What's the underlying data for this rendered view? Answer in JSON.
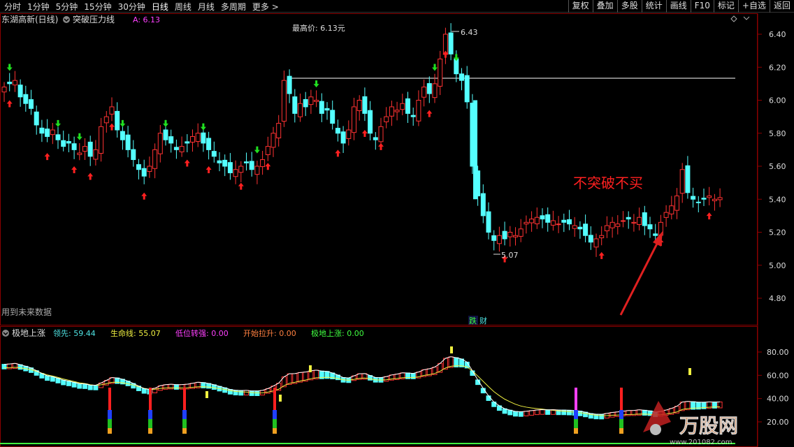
{
  "toolbar": {
    "left_items": [
      "分时",
      "1分钟",
      "5分钟",
      "15分钟",
      "30分钟",
      "日线",
      "周线",
      "月线",
      "多周期",
      "更多 >"
    ],
    "right_items": [
      "复权",
      "叠加",
      "多股",
      "统计",
      "画线",
      "F10",
      "标记",
      "+自选",
      "返回"
    ]
  },
  "main_panel": {
    "stock_name": "东湖高新(日线)",
    "indicator_name": "突破压力线",
    "indicator_value": "A: 6.13",
    "top_note": "最高价: 6.13元",
    "future_note": "用到未来数据",
    "annotation": "不突破不买",
    "high_label": "6.43",
    "low_label": "5.07",
    "badge_1": "跌",
    "badge_2": "财",
    "y_axis": [
      "6.40",
      "6.20",
      "6.00",
      "5.80",
      "5.60",
      "5.40",
      "5.20",
      "5.00",
      "4.80"
    ]
  },
  "sub_panel": {
    "title": "极地上涨",
    "indicators": [
      {
        "label": "领先:",
        "value": "59.44",
        "color": "#4fe3e3"
      },
      {
        "label": "生命线:",
        "value": "55.07",
        "color": "#f0f040"
      },
      {
        "label": "低位转强:",
        "value": "0.00",
        "color": "#ff40ff"
      },
      {
        "label": "开始拉升:",
        "value": "0.00",
        "color": "#ff8040"
      },
      {
        "label": "极地上涨:",
        "value": "0.00",
        "color": "#40ff40"
      }
    ],
    "y_axis": [
      "80.00",
      "60.00",
      "40.00",
      "20.00"
    ]
  },
  "watermark": {
    "brand": "万股网",
    "url": "www.201082.com"
  },
  "colors": {
    "up": "#ff3232",
    "down": "#54ffff",
    "resistance": "#ffffff",
    "life_line": "#f0f040",
    "lead_line": "#ffffff"
  }
}
